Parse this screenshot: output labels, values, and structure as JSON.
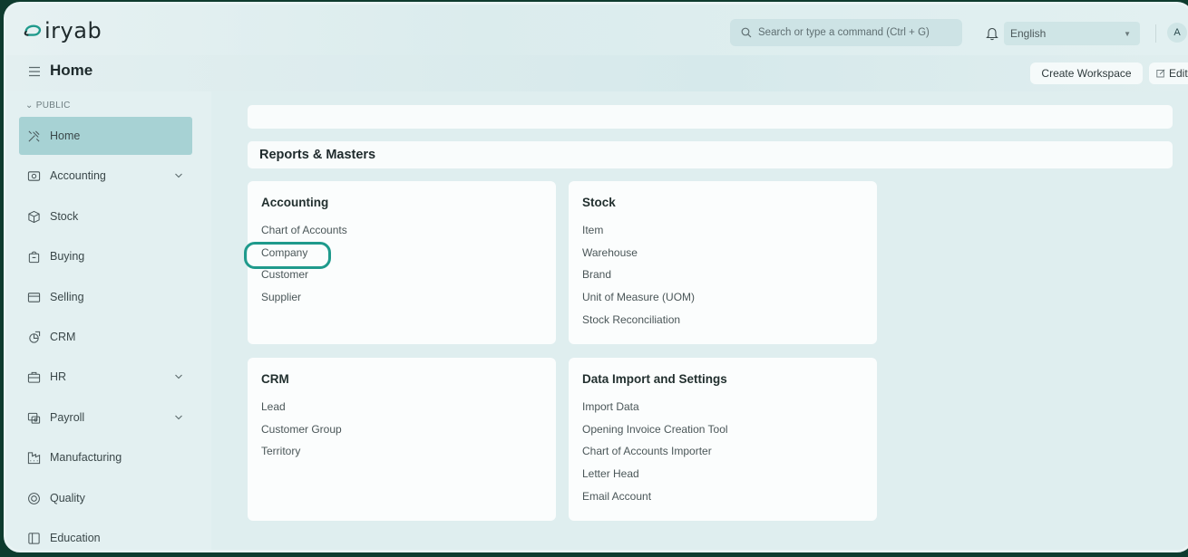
{
  "brand": {
    "logo_text": "iryab",
    "accent": "#1f9a8c"
  },
  "topbar": {
    "search_placeholder": "Search or type a command (Ctrl + G)",
    "language": "English",
    "avatar_initial": "A"
  },
  "header": {
    "page_title": "Home",
    "create_workspace": "Create Workspace",
    "edit": "Edit"
  },
  "sidebar": {
    "section_label": "PUBLIC",
    "items": [
      {
        "label": "Home",
        "icon": "tools-icon",
        "active": true,
        "expandable": false
      },
      {
        "label": "Accounting",
        "icon": "accounting-icon",
        "expandable": true
      },
      {
        "label": "Stock",
        "icon": "cube-icon",
        "expandable": false
      },
      {
        "label": "Buying",
        "icon": "bag-icon",
        "expandable": false
      },
      {
        "label": "Selling",
        "icon": "selling-icon",
        "expandable": false
      },
      {
        "label": "CRM",
        "icon": "crm-icon",
        "expandable": false
      },
      {
        "label": "HR",
        "icon": "briefcase-icon",
        "expandable": true
      },
      {
        "label": "Payroll",
        "icon": "payroll-icon",
        "expandable": true
      },
      {
        "label": "Manufacturing",
        "icon": "factory-icon",
        "expandable": false
      },
      {
        "label": "Quality",
        "icon": "quality-icon",
        "expandable": false
      },
      {
        "label": "Education",
        "icon": "book-icon",
        "expandable": false
      }
    ]
  },
  "main": {
    "section_title": "Reports & Masters",
    "cards": [
      {
        "title": "Accounting",
        "links": [
          "Chart of Accounts",
          "Company",
          "Customer",
          "Supplier"
        ]
      },
      {
        "title": "Stock",
        "links": [
          "Item",
          "Warehouse",
          "Brand",
          "Unit of Measure (UOM)",
          "Stock Reconciliation"
        ]
      },
      {
        "title": "CRM",
        "links": [
          "Lead",
          "Customer Group",
          "Territory"
        ]
      },
      {
        "title": "Data Import and Settings",
        "links": [
          "Import Data",
          "Opening Invoice Creation Tool",
          "Chart of Accounts Importer",
          "Letter Head",
          "Email Account"
        ]
      }
    ]
  }
}
